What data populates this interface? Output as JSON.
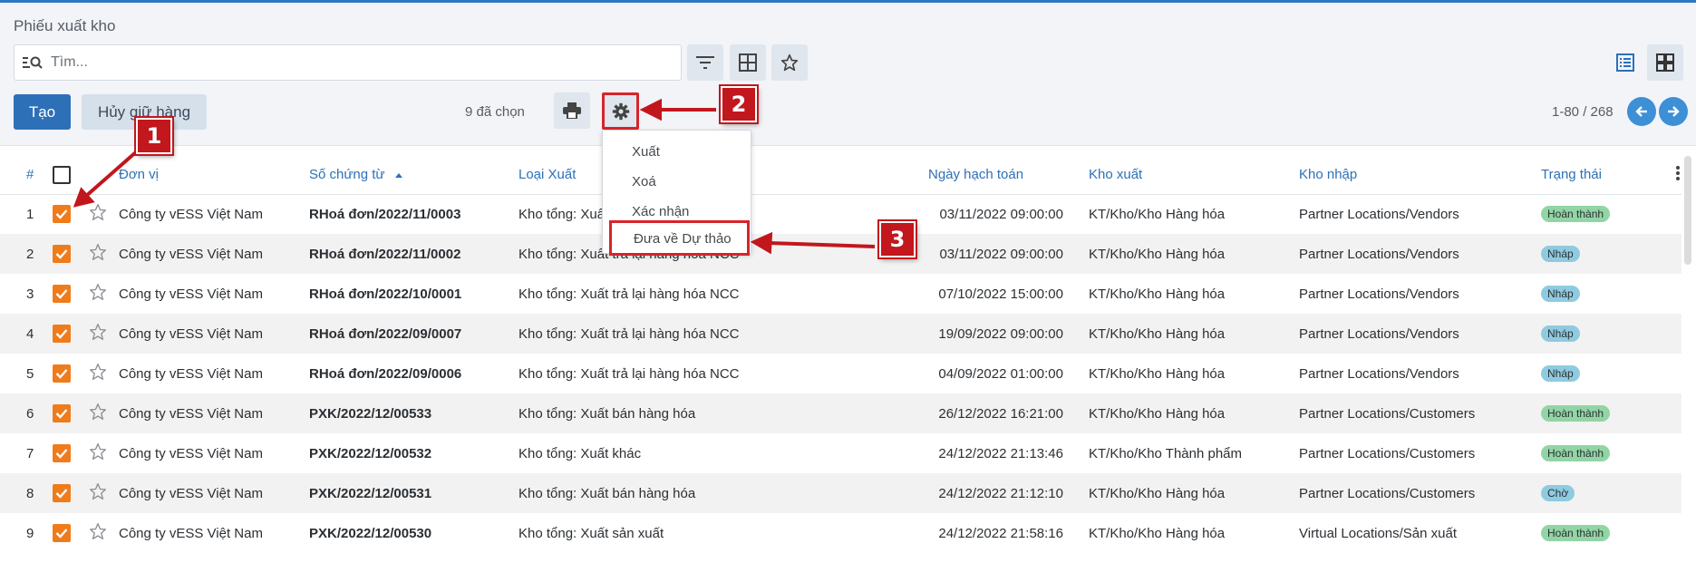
{
  "page": {
    "title": "Phiếu xuất kho"
  },
  "search": {
    "placeholder": "Tìm..."
  },
  "toolbar": {
    "create_label": "Tạo",
    "cancel_hold_label": "Hủy giữ hàng",
    "selected_count": "9 đã chọn"
  },
  "pager": {
    "text": "1-80 / 268"
  },
  "action_menu": {
    "items": [
      "Xuất",
      "Xoá",
      "Xác nhận",
      "Đưa về Dự thảo"
    ]
  },
  "callouts": [
    "1",
    "2",
    "3"
  ],
  "table": {
    "headers": [
      "#",
      "Đơn vị",
      "Số chứng từ",
      "Loại Xuất",
      "Ngày hạch toán",
      "Kho xuất",
      "Kho nhập",
      "Trạng thái"
    ],
    "rows": [
      {
        "n": "1",
        "unit": "Công ty vESS Việt Nam",
        "doc": "RHoá đơn/2022/11/0003",
        "type": "Kho tổng: Xuất trả lại hàng hóa NCC",
        "date": "03/11/2022 09:00:00",
        "from": "KT/Kho/Kho Hàng hóa",
        "to": "Partner Locations/Vendors",
        "status": "Hoàn thành",
        "status_kind": "green"
      },
      {
        "n": "2",
        "unit": "Công ty vESS Việt Nam",
        "doc": "RHoá đơn/2022/11/0002",
        "type": "Kho tổng: Xuất trả lại hàng hóa NCC",
        "date": "03/11/2022 09:00:00",
        "from": "KT/Kho/Kho Hàng hóa",
        "to": "Partner Locations/Vendors",
        "status": "Nháp",
        "status_kind": "blue"
      },
      {
        "n": "3",
        "unit": "Công ty vESS Việt Nam",
        "doc": "RHoá đơn/2022/10/0001",
        "type": "Kho tổng: Xuất trả lại hàng hóa NCC",
        "date": "07/10/2022 15:00:00",
        "from": "KT/Kho/Kho Hàng hóa",
        "to": "Partner Locations/Vendors",
        "status": "Nháp",
        "status_kind": "blue"
      },
      {
        "n": "4",
        "unit": "Công ty vESS Việt Nam",
        "doc": "RHoá đơn/2022/09/0007",
        "type": "Kho tổng: Xuất trả lại hàng hóa NCC",
        "date": "19/09/2022 09:00:00",
        "from": "KT/Kho/Kho Hàng hóa",
        "to": "Partner Locations/Vendors",
        "status": "Nháp",
        "status_kind": "blue"
      },
      {
        "n": "5",
        "unit": "Công ty vESS Việt Nam",
        "doc": "RHoá đơn/2022/09/0006",
        "type": "Kho tổng: Xuất trả lại hàng hóa NCC",
        "date": "04/09/2022 01:00:00",
        "from": "KT/Kho/Kho Hàng hóa",
        "to": "Partner Locations/Vendors",
        "status": "Nháp",
        "status_kind": "blue"
      },
      {
        "n": "6",
        "unit": "Công ty vESS Việt Nam",
        "doc": "PXK/2022/12/00533",
        "type": "Kho tổng: Xuất bán hàng hóa",
        "date": "26/12/2022 16:21:00",
        "from": "KT/Kho/Kho Hàng hóa",
        "to": "Partner Locations/Customers",
        "status": "Hoàn thành",
        "status_kind": "green"
      },
      {
        "n": "7",
        "unit": "Công ty vESS Việt Nam",
        "doc": "PXK/2022/12/00532",
        "type": "Kho tổng: Xuất khác",
        "date": "24/12/2022 21:13:46",
        "from": "KT/Kho/Kho Thành phẩm",
        "to": "Partner Locations/Customers",
        "status": "Hoàn thành",
        "status_kind": "green"
      },
      {
        "n": "8",
        "unit": "Công ty vESS Việt Nam",
        "doc": "PXK/2022/12/00531",
        "type": "Kho tổng: Xuất bán hàng hóa",
        "date": "24/12/2022 21:12:10",
        "from": "KT/Kho/Kho Hàng hóa",
        "to": "Partner Locations/Customers",
        "status": "Chờ",
        "status_kind": "blue"
      },
      {
        "n": "9",
        "unit": "Công ty vESS Việt Nam",
        "doc": "PXK/2022/12/00530",
        "type": "Kho tổng: Xuất sản xuất",
        "date": "24/12/2022 21:58:16",
        "from": "KT/Kho/Kho Hàng hóa",
        "to": "Virtual Locations/Sản xuất",
        "status": "Hoàn thành",
        "status_kind": "green"
      }
    ]
  }
}
